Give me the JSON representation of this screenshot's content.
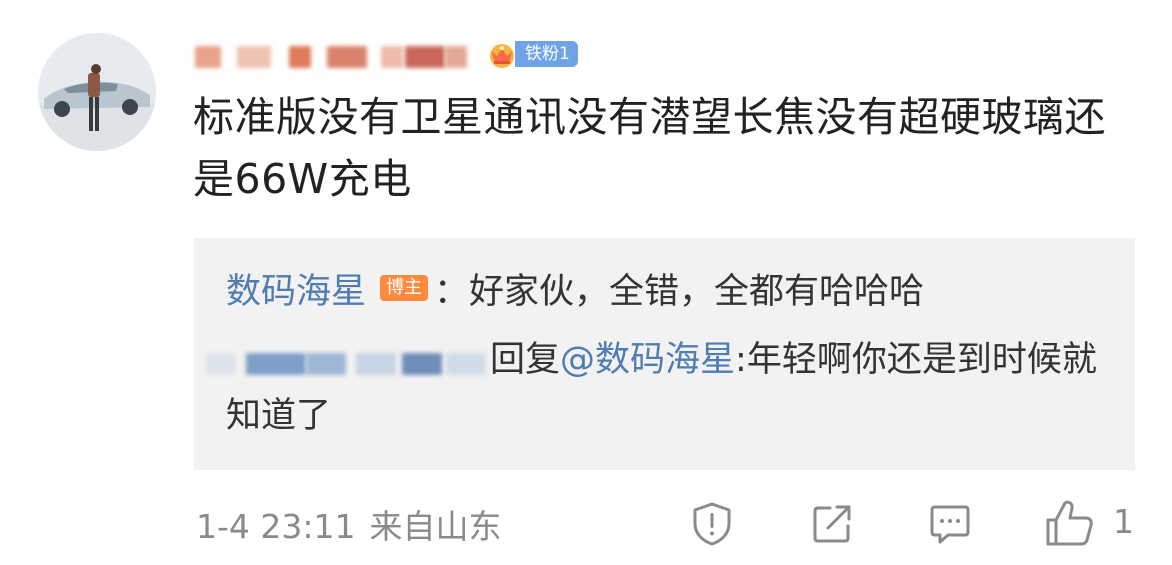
{
  "comment": {
    "user": {
      "name_redacted": "用户名",
      "fan_badge": "铁粉1"
    },
    "text": "标准版没有卫星通讯没有潜望长焦没有超硬玻璃还是66W充电",
    "reply": {
      "author": "数码海星",
      "author_badge": "博主",
      "separator": "：",
      "text": "好家伙，全错，全都有哈哈哈",
      "sub_reply_prefix": "回复",
      "sub_reply_mention": "@数码海星",
      "sub_reply_text": ":年轻啊你还是到时候就知道了"
    },
    "footer": {
      "time": "1-4 23:11",
      "location": "来自山东",
      "like_count": "1"
    }
  },
  "colors": {
    "link": "#4f7cb2",
    "fan_badge_bg": "#6ea4e6",
    "blogger_badge_bg": "#ff8a3d",
    "meta_gray": "#8a8a8a"
  },
  "icons": [
    "avatar-car",
    "crown-icon",
    "report-icon",
    "share-icon",
    "comment-icon",
    "like-icon"
  ]
}
